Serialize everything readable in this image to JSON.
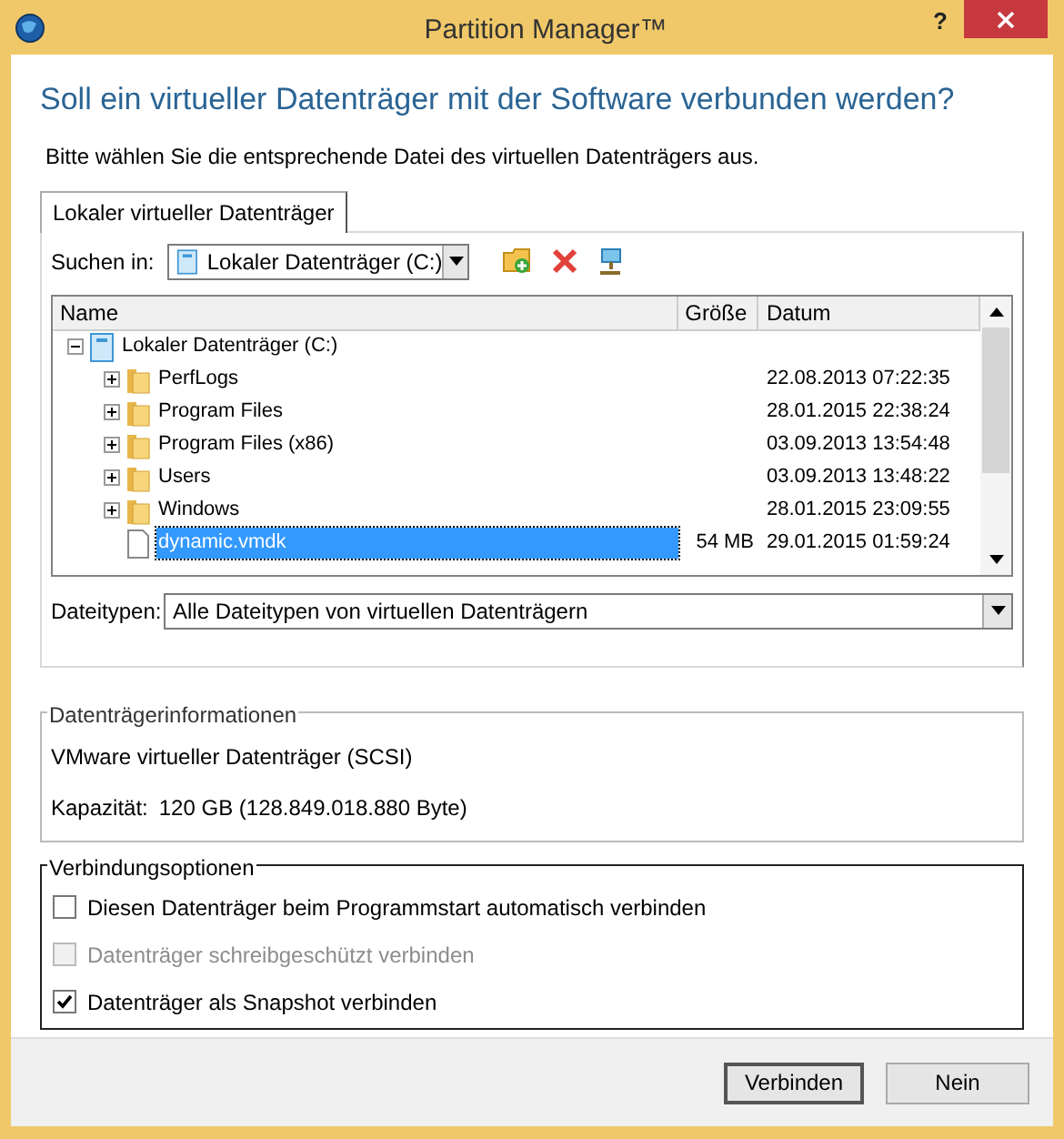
{
  "window": {
    "title": "Partition Manager™",
    "help": "?"
  },
  "heading": "Soll ein virtueller Datenträger mit der Software verbunden werden?",
  "instruction": "Bitte wählen Sie die entsprechende Datei des virtuellen Datenträgers aus.",
  "tabs": [
    {
      "label": "Lokaler virtueller Datenträger",
      "selected": true
    }
  ],
  "search_in": {
    "label": "Suchen in:",
    "value": "Lokaler Datenträger (C:)"
  },
  "file_list": {
    "columns": [
      "Name",
      "Größe",
      "Datum"
    ],
    "items": [
      {
        "name": "Lokaler Datenträger (C:)",
        "kind": "drive",
        "expanded": true,
        "selected": false,
        "children": [
          {
            "name": "PerfLogs",
            "kind": "folder",
            "expanded": false,
            "selected": false,
            "date": "22.08.2013 07:22:35"
          },
          {
            "name": "Program Files",
            "kind": "folder",
            "expanded": false,
            "selected": false,
            "date": "28.01.2015 22:38:24"
          },
          {
            "name": "Program Files (x86)",
            "kind": "folder",
            "expanded": false,
            "selected": false,
            "date": "03.09.2013 13:54:48"
          },
          {
            "name": "Users",
            "kind": "folder",
            "expanded": false,
            "selected": false,
            "date": "03.09.2013 13:48:22"
          },
          {
            "name": "Windows",
            "kind": "folder",
            "expanded": false,
            "selected": false,
            "date": "28.01.2015 23:09:55"
          },
          {
            "name": "dynamic.vmdk",
            "kind": "file",
            "selected": true,
            "size": "54 MB",
            "date": "29.01.2015 01:59:24"
          }
        ]
      }
    ]
  },
  "file_types": {
    "label": "Dateitypen:",
    "value": "Alle Dateitypen von virtuellen Datenträgern"
  },
  "disk_info": {
    "title": "Datenträgerinformationen",
    "type": "VMware virtueller Datenträger (SCSI)",
    "capacity_label": "Kapazität:",
    "capacity": "120 GB (128.849.018.880 Byte)"
  },
  "connection_options": {
    "title": "Verbindungsoptionen",
    "options": [
      {
        "label": "Diesen Datenträger beim Programmstart automatisch verbinden",
        "checked": false,
        "disabled": false
      },
      {
        "label": "Datenträger schreibgeschützt verbinden",
        "checked": false,
        "disabled": true
      },
      {
        "label": "Datenträger als Snapshot verbinden",
        "checked": true,
        "disabled": false
      }
    ]
  },
  "buttons": [
    {
      "label": "Verbinden",
      "default": true
    },
    {
      "label": "Nein",
      "default": false
    }
  ]
}
